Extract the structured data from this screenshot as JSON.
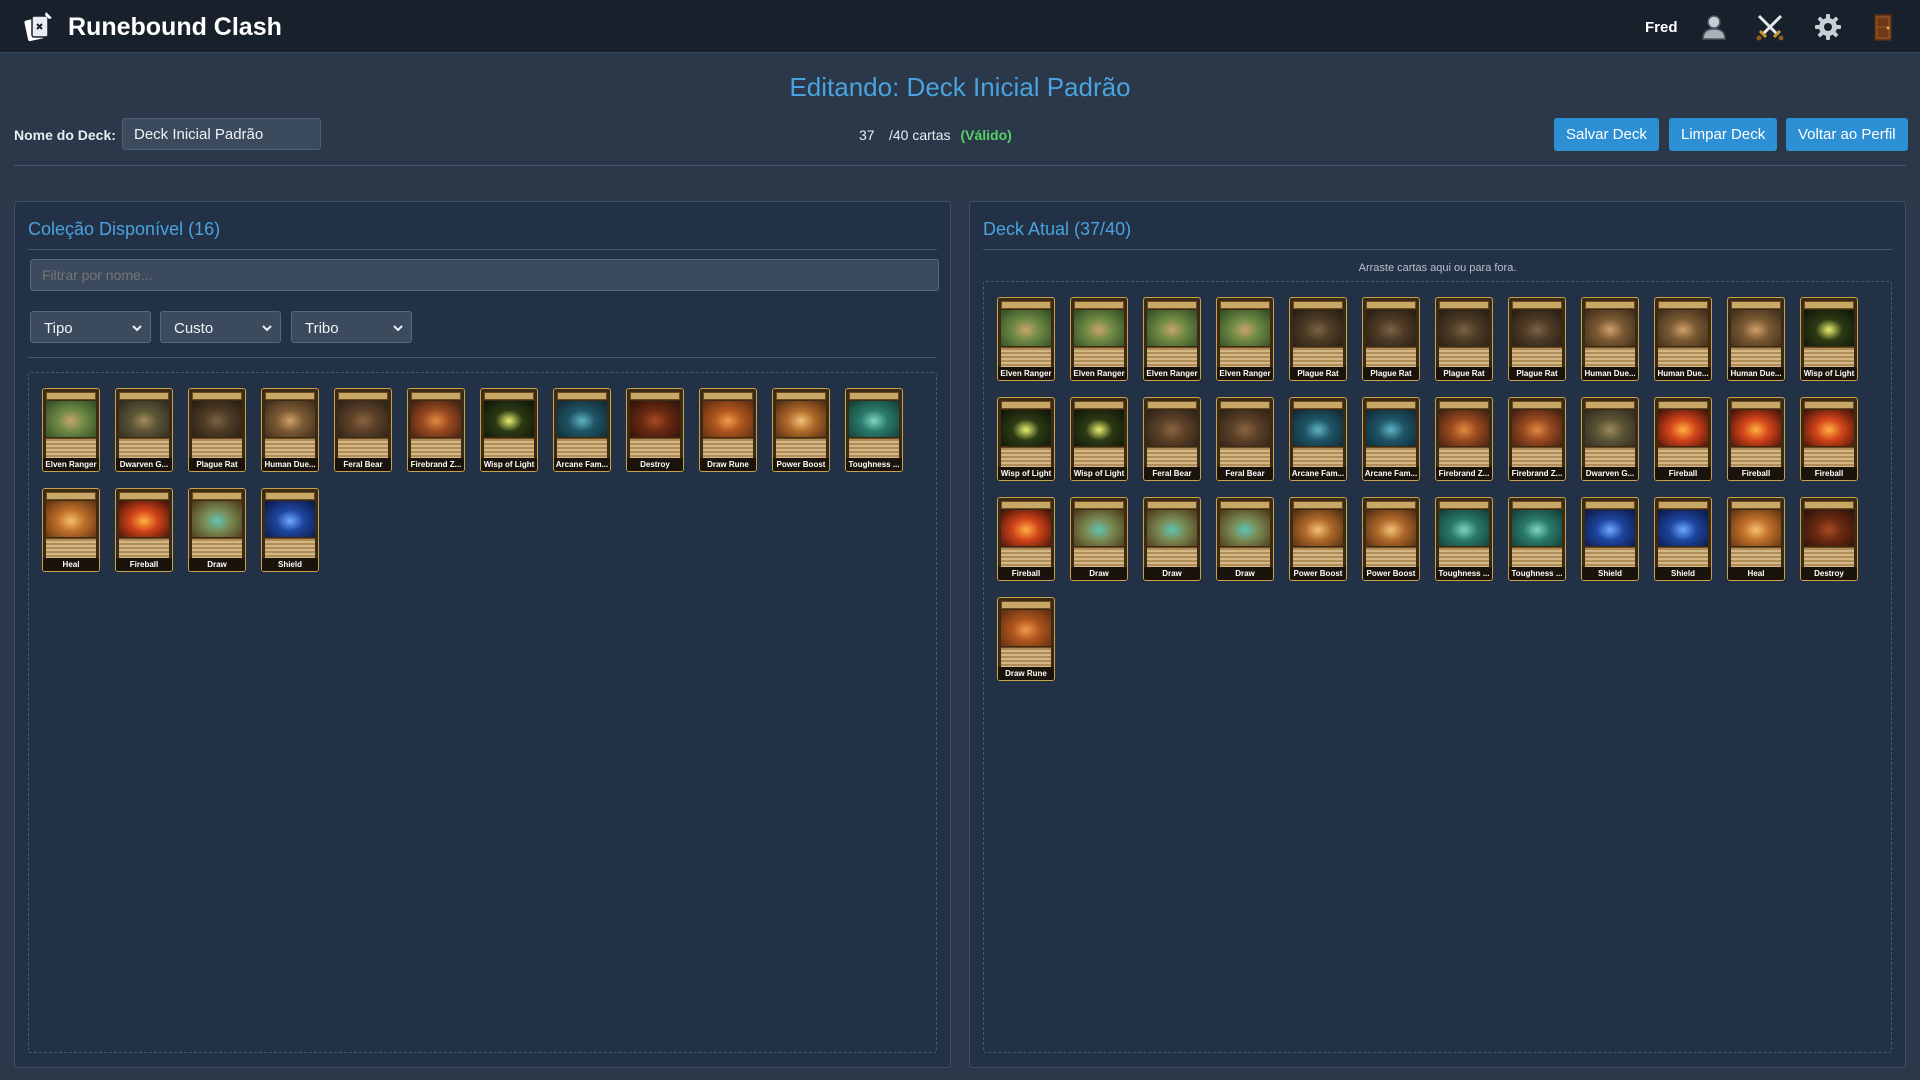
{
  "app": {
    "title": "Runebound Clash",
    "username": "Fred"
  },
  "nav_icons": [
    "profile-icon",
    "battle-swords-icon",
    "gear-icon",
    "exit-door-icon"
  ],
  "editor": {
    "page_title": "Editando: Deck Inicial Padrão",
    "deck_name_label": "Nome do Deck:",
    "deck_name_value": "Deck Inicial Padrão",
    "card_count": "37",
    "card_count_suffix": "/40 cartas",
    "status": "(Válido)",
    "buttons": {
      "save": "Salvar Deck",
      "clear": "Limpar Deck",
      "back": "Voltar ao Perfil"
    }
  },
  "collection": {
    "title": "Coleção Disponível (16)",
    "filter_placeholder": "Filtrar por nome...",
    "filters": {
      "type": "Tipo",
      "cost": "Custo",
      "tribe": "Tribo"
    },
    "cards": [
      {
        "name": "Elven Ranger",
        "art": "forest"
      },
      {
        "name": "Dwarven G...",
        "art": "dwarf"
      },
      {
        "name": "Plague Rat",
        "art": "rat"
      },
      {
        "name": "Human Due...",
        "art": "duelist"
      },
      {
        "name": "Feral Bear",
        "art": "bear"
      },
      {
        "name": "Firebrand Z...",
        "art": "zealot"
      },
      {
        "name": "Wisp of Light",
        "art": "wisp"
      },
      {
        "name": "Arcane Fam...",
        "art": "arcane"
      },
      {
        "name": "Destroy",
        "art": "destroy"
      },
      {
        "name": "Draw Rune",
        "art": "rune"
      },
      {
        "name": "Power Boost",
        "art": "boost"
      },
      {
        "name": "Toughness ...",
        "art": "tough"
      },
      {
        "name": "Heal",
        "art": "heal"
      },
      {
        "name": "Fireball",
        "art": "fire"
      },
      {
        "name": "Draw",
        "art": "draw"
      },
      {
        "name": "Shield",
        "art": "shield"
      }
    ]
  },
  "deck": {
    "title": "Deck Atual (37/40)",
    "drop_hint": "Arraste cartas aqui ou para fora.",
    "cards": [
      {
        "name": "Elven Ranger",
        "art": "forest"
      },
      {
        "name": "Elven Ranger",
        "art": "forest"
      },
      {
        "name": "Elven Ranger",
        "art": "forest"
      },
      {
        "name": "Elven Ranger",
        "art": "forest"
      },
      {
        "name": "Plague Rat",
        "art": "rat"
      },
      {
        "name": "Plague Rat",
        "art": "rat"
      },
      {
        "name": "Plague Rat",
        "art": "rat"
      },
      {
        "name": "Plague Rat",
        "art": "rat"
      },
      {
        "name": "Human Due...",
        "art": "duelist"
      },
      {
        "name": "Human Due...",
        "art": "duelist"
      },
      {
        "name": "Human Due...",
        "art": "duelist"
      },
      {
        "name": "Wisp of Light",
        "art": "wisp"
      },
      {
        "name": "Wisp of Light",
        "art": "wisp"
      },
      {
        "name": "Wisp of Light",
        "art": "wisp"
      },
      {
        "name": "Feral Bear",
        "art": "bear"
      },
      {
        "name": "Feral Bear",
        "art": "bear"
      },
      {
        "name": "Arcane Fam...",
        "art": "arcane"
      },
      {
        "name": "Arcane Fam...",
        "art": "arcane"
      },
      {
        "name": "Firebrand Z...",
        "art": "zealot"
      },
      {
        "name": "Firebrand Z...",
        "art": "zealot"
      },
      {
        "name": "Dwarven G...",
        "art": "dwarf"
      },
      {
        "name": "Fireball",
        "art": "fire"
      },
      {
        "name": "Fireball",
        "art": "fire"
      },
      {
        "name": "Fireball",
        "art": "fire"
      },
      {
        "name": "Fireball",
        "art": "fire"
      },
      {
        "name": "Draw",
        "art": "draw"
      },
      {
        "name": "Draw",
        "art": "draw"
      },
      {
        "name": "Draw",
        "art": "draw"
      },
      {
        "name": "Power Boost",
        "art": "boost"
      },
      {
        "name": "Power Boost",
        "art": "boost"
      },
      {
        "name": "Toughness ...",
        "art": "tough"
      },
      {
        "name": "Toughness ...",
        "art": "tough"
      },
      {
        "name": "Shield",
        "art": "shield"
      },
      {
        "name": "Shield",
        "art": "shield"
      },
      {
        "name": "Heal",
        "art": "heal"
      },
      {
        "name": "Destroy",
        "art": "destroy"
      },
      {
        "name": "Draw Rune",
        "art": "rune"
      }
    ]
  },
  "colors": {
    "accent": "#4aa3df",
    "button": "#2d8fd4",
    "valid": "#56d364",
    "card_border": "#c9a146",
    "background": "#2a3849",
    "topbar": "#17202b"
  }
}
